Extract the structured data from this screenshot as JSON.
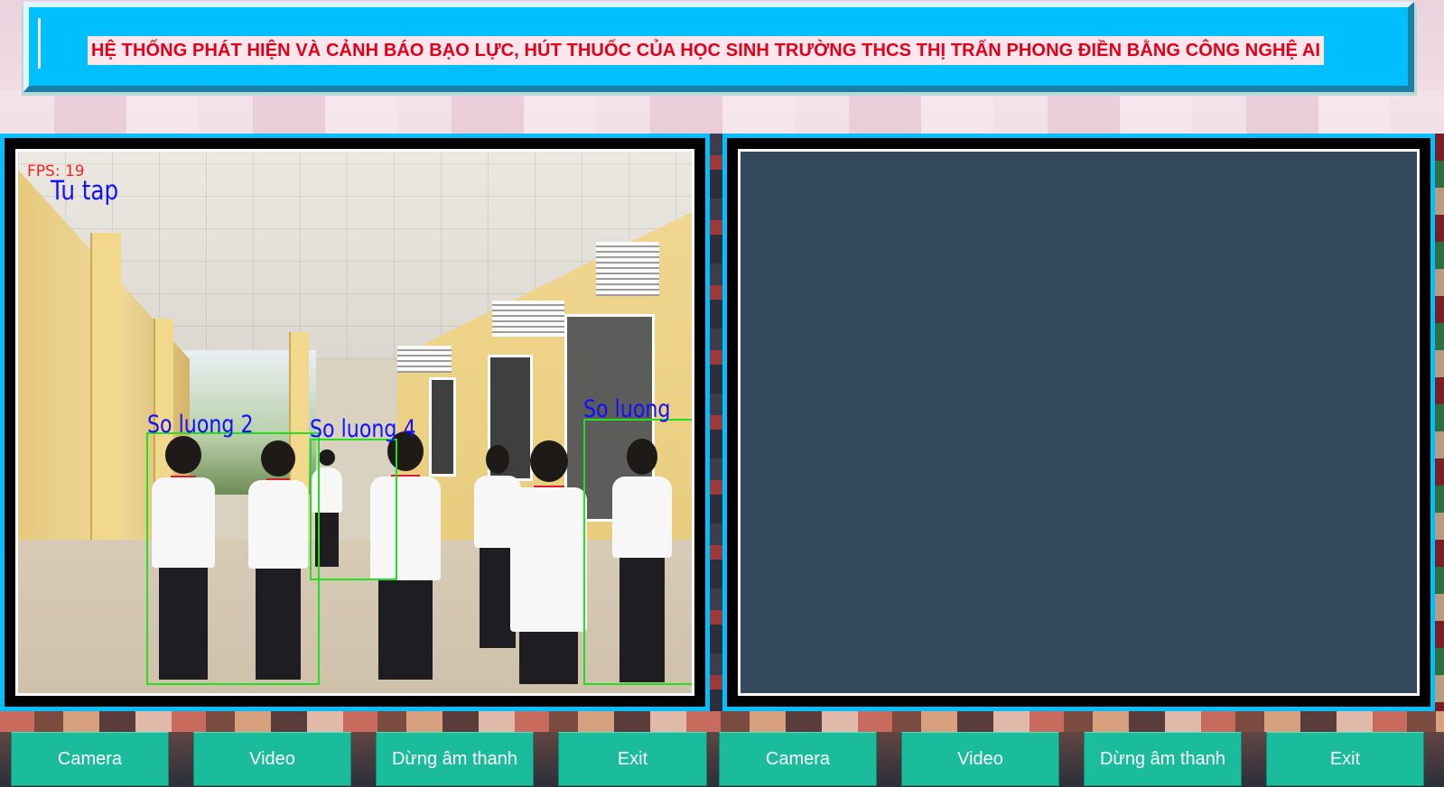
{
  "banner": {
    "title": "HỆ THỐNG PHÁT HIỆN VÀ CẢNH BÁO BẠO LỰC, HÚT THUỐC CỦA HỌC SINH TRƯỜNG THCS THỊ TRẤN PHONG ĐIỀN BẰNG CÔNG NGHỆ AI"
  },
  "left_view": {
    "fps_text": "FPS: 19",
    "status_text": "Tu tap",
    "detections": [
      {
        "label": "So luong 2"
      },
      {
        "label": "So luong 4"
      },
      {
        "label": "So luong"
      }
    ]
  },
  "right_view": {},
  "buttons_left": {
    "camera": "Camera",
    "video": "Video",
    "mute": "Dừng âm thanh",
    "exit": "Exit"
  },
  "buttons_right": {
    "camera": "Camera",
    "video": "Video",
    "mute": "Dừng âm thanh",
    "exit": "Exit"
  },
  "colors": {
    "banner": "#00bfff",
    "title_text": "#e0001b",
    "button": "#1abc9c",
    "right_view_bg": "#34495e",
    "detection_box": "#22e01f",
    "detection_label": "#1010ff"
  }
}
